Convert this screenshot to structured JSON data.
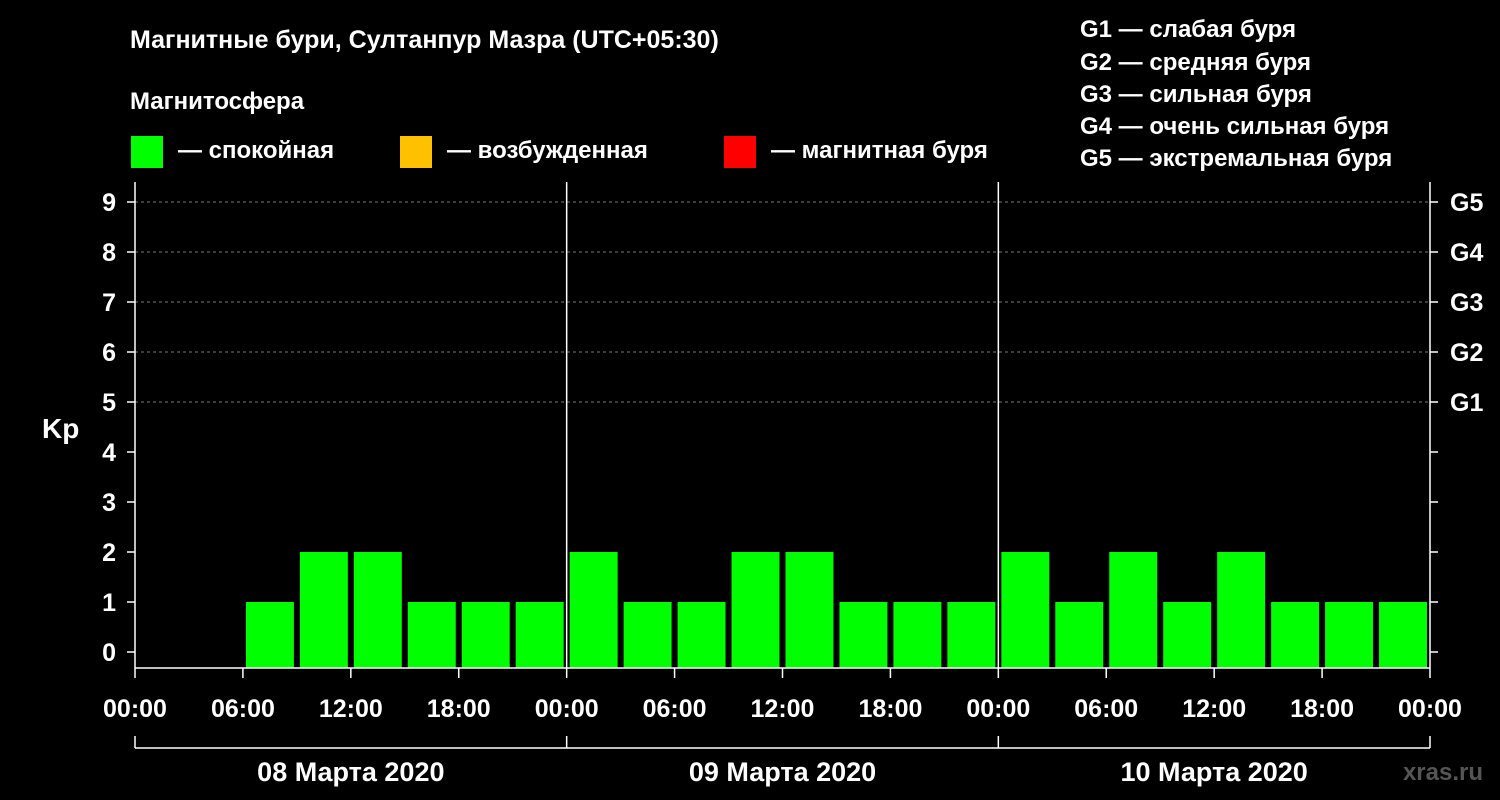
{
  "chart_data": {
    "type": "bar",
    "title": "Магнитные бури, Султанпур Мазра (UTC+05:30)",
    "legend_title": "Магнитосфера",
    "legend": [
      {
        "label": "— спокойная",
        "color": "#00ff00"
      },
      {
        "label": "— возбужденная",
        "color": "#ffc000"
      },
      {
        "label": "— магнитная буря",
        "color": "#ff0000"
      }
    ],
    "g_scale": [
      "G1 — слабая буря",
      "G2 — средняя буря",
      "G3 — сильная буря",
      "G4 — очень сильная буря",
      "G5 — экстремальная буря"
    ],
    "ylabel": "Kp",
    "ylim": [
      0,
      9
    ],
    "y_ticks": [
      "0",
      "1",
      "2",
      "3",
      "4",
      "5",
      "6",
      "7",
      "8",
      "9"
    ],
    "right_ticks": [
      {
        "label": "G1",
        "kp": 5
      },
      {
        "label": "G2",
        "kp": 6
      },
      {
        "label": "G3",
        "kp": 7
      },
      {
        "label": "G4",
        "kp": 8
      },
      {
        "label": "G5",
        "kp": 9
      }
    ],
    "x_ticks": [
      "00:00",
      "06:00",
      "12:00",
      "18:00",
      "00:00",
      "06:00",
      "12:00",
      "18:00",
      "00:00",
      "06:00",
      "12:00",
      "18:00",
      "00:00"
    ],
    "days": [
      "08 Марта 2020",
      "09 Марта 2020",
      "10 Марта 2020"
    ],
    "values": [
      null,
      1,
      2,
      2,
      1,
      1,
      1,
      2,
      1,
      1,
      2,
      2,
      1,
      1,
      1,
      2,
      1,
      2,
      1,
      2,
      1,
      1,
      1
    ],
    "bar_color": "#00ff00",
    "grid": true,
    "watermark": "xras.ru"
  }
}
